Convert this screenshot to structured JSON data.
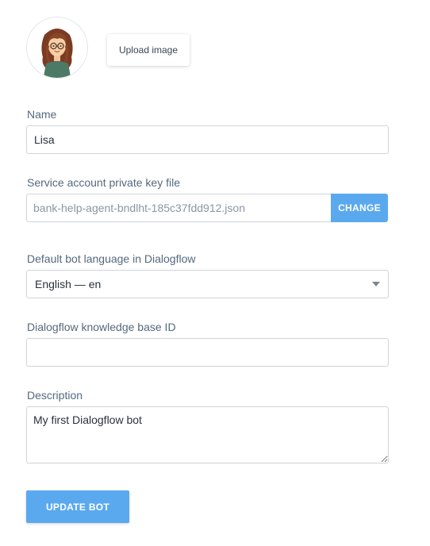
{
  "avatar": {
    "icon": "cartoon-woman-avatar"
  },
  "upload": {
    "label": "Upload image"
  },
  "name_field": {
    "label": "Name",
    "value": "Lisa"
  },
  "key_file": {
    "label": "Service account private key file",
    "value": "bank-help-agent-bndlht-185c37fdd912.json",
    "change_label": "CHANGE"
  },
  "language": {
    "label": "Default bot language in Dialogflow",
    "selected": "English — en"
  },
  "knowledge_base": {
    "label": "Dialogflow knowledge base ID",
    "value": ""
  },
  "description": {
    "label": "Description",
    "value": "My first Dialogflow bot"
  },
  "submit": {
    "label": "UPDATE BOT"
  },
  "colors": {
    "accent": "#5aa9ef",
    "label": "#55697c",
    "border": "#cfd4d9"
  }
}
